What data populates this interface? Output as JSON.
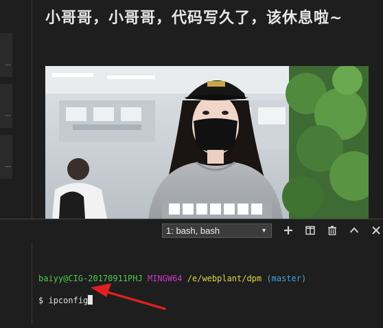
{
  "article": {
    "title": "小哥哥，小哥哥，代码写久了，该休息啦~"
  },
  "left_gutter": {
    "cards": [
      "…",
      "…",
      "…"
    ]
  },
  "terminal": {
    "selected_terminal": "1: bash, bash",
    "prompt": {
      "user_host": "baiyy@CIG-20170911PHJ",
      "system": "MINGW64",
      "path": "/e/webplant/dpm",
      "branch": "(master)"
    },
    "command_symbol": "$",
    "command": "ipconfig"
  },
  "icons": {
    "new_terminal": "plus-icon",
    "split_terminal": "split-icon",
    "kill_terminal": "trash-icon",
    "maximize_panel": "chevron-up-icon",
    "close_panel": "close-icon"
  },
  "colors": {
    "background": "#1e1e1e",
    "prompt_user": "#4ec94e",
    "prompt_system": "#c837c8",
    "prompt_path": "#d7d746",
    "prompt_branch": "#3fa7e0",
    "arrow": "#e02020"
  }
}
